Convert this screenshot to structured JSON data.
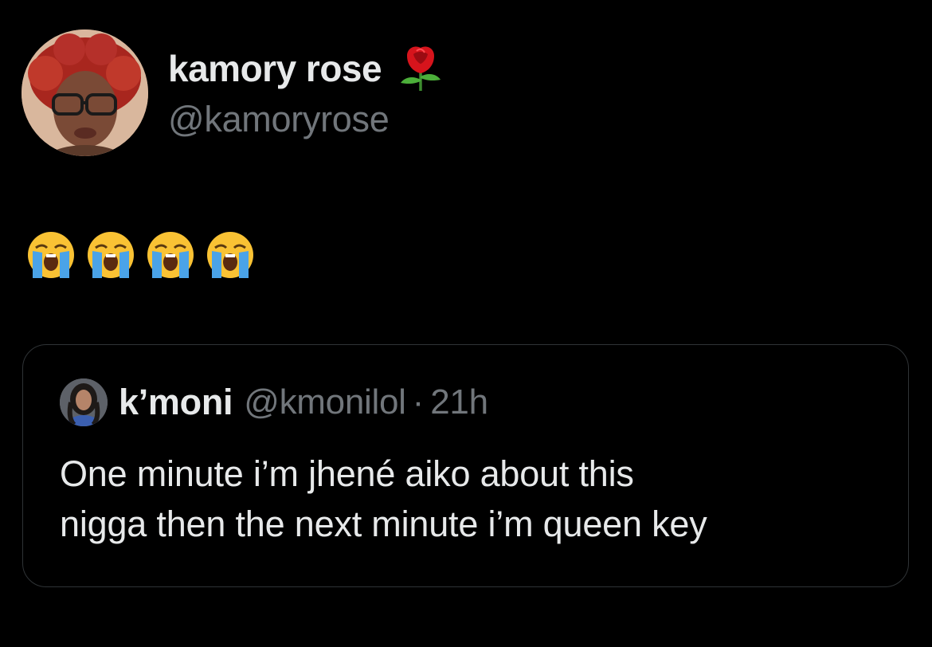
{
  "tweet": {
    "author": {
      "display_name": "kamory rose",
      "name_emoji": "rose-icon",
      "handle": "@kamoryrose",
      "avatar": "avatar-photo"
    },
    "body_emojis": [
      "loudly-crying-face-icon",
      "loudly-crying-face-icon",
      "loudly-crying-face-icon",
      "loudly-crying-face-icon"
    ],
    "quoted_tweet": {
      "author_name": "k’moni",
      "author_handle": "@kmonilol",
      "separator": "·",
      "time": "21h",
      "text": "One minute i’m jhené aiko about this\nnigga then the next minute i’m queen key"
    }
  },
  "colors": {
    "background": "#000000",
    "primary_text": "#e7e9ea",
    "secondary_text": "#71767b",
    "card_border": "#2f3336"
  }
}
